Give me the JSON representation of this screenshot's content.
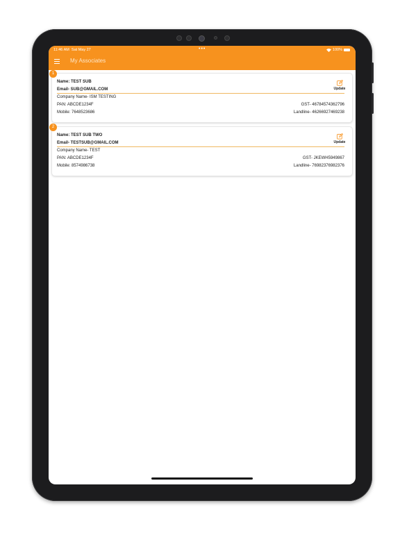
{
  "status_bar": {
    "time": "11:46 AM",
    "date": "Sat May 27",
    "dots": "•••",
    "battery": "100%"
  },
  "appbar": {
    "title": "My Associates"
  },
  "colors": {
    "accent": "#f7921e",
    "text": "#222222",
    "divider": "#f0b860"
  },
  "icons": {
    "menu": "hamburger-menu-icon",
    "update": "edit-icon"
  },
  "associates": [
    {
      "index": "1",
      "name": "Name: TEST SUB",
      "email": "Email- SUB@GMAIL.COM",
      "company": "Company Name- ISM TESTING",
      "pan": "PAN: ABCDE1234F",
      "gst": "GST- 46784574362796",
      "mobile": "Mobile: 7648523686",
      "landline": "Landline- 46266927469238",
      "update_label": "Update"
    },
    {
      "index": "2",
      "name": "Name: TEST SUB TWO",
      "email": "Email- TESTSUB@GMAIL.COM",
      "company": "Company Name- TEST",
      "pan": "PAN: ABCDE1234F",
      "gst": "GST- JKEWH5949867",
      "mobile": "Mobile: 8574986738",
      "landline": "Landline- 76982376982376",
      "update_label": "Update"
    }
  ]
}
